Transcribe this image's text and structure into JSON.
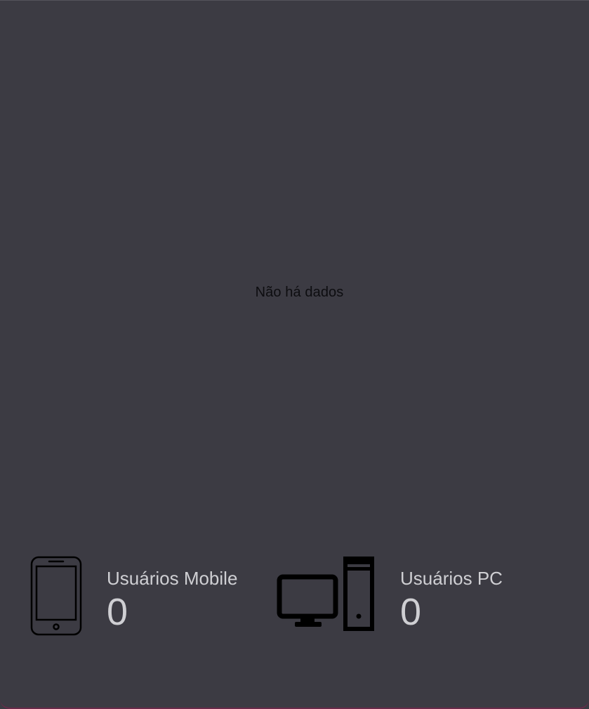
{
  "chart": {
    "empty_message": "Não há dados"
  },
  "stats": {
    "mobile": {
      "icon": "smartphone-icon",
      "label": "Usuários Mobile",
      "value": "0"
    },
    "pc": {
      "icon": "desktop-computer-icon",
      "label": "Usuários PC",
      "value": "0"
    }
  },
  "colors": {
    "background": "#3c3b43",
    "text_muted": "#cfcfd3",
    "empty_text": "#0d0d10",
    "accent_border": "#6b2a4a"
  }
}
